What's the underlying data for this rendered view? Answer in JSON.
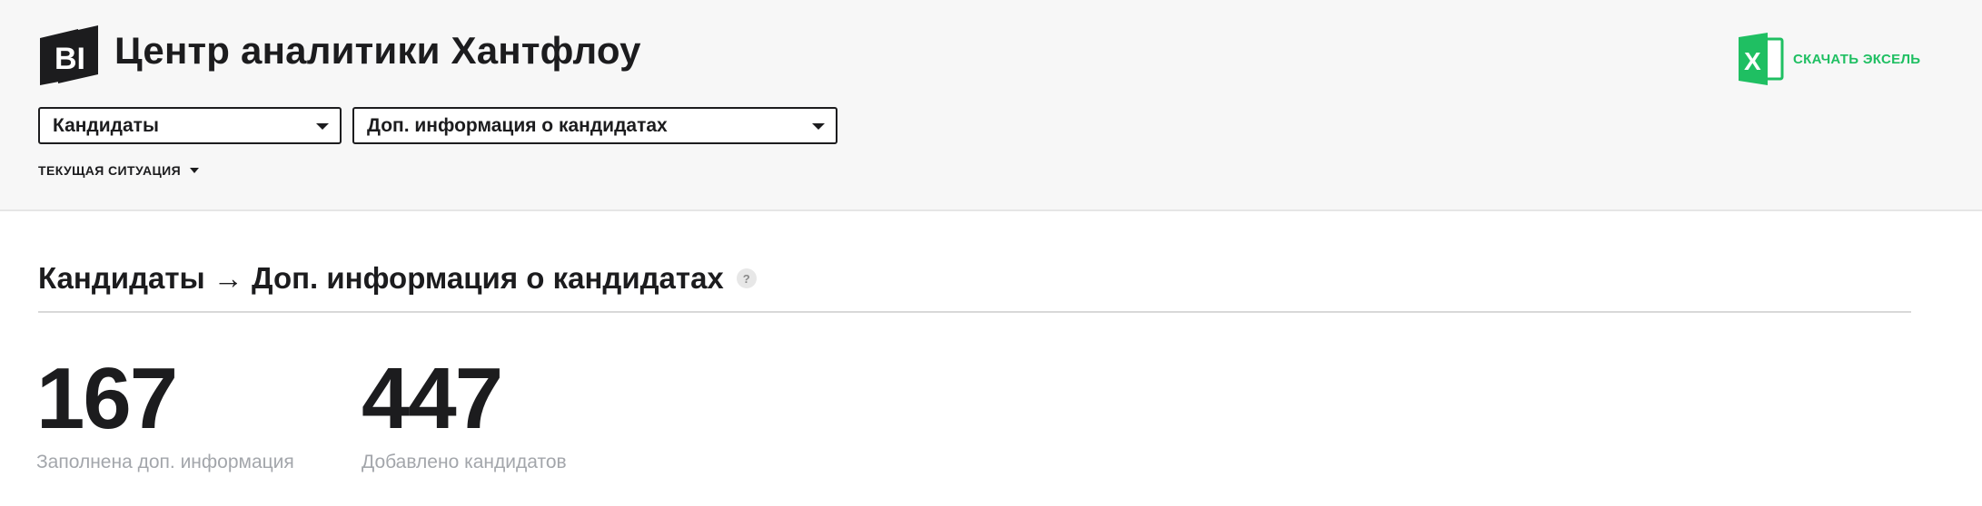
{
  "header": {
    "logo_text": "BI",
    "title": "Центр аналитики Хантфлоу",
    "excel": {
      "icon": "excel-icon",
      "icon_letter": "X",
      "label": "СКАЧАТЬ ЭКСЕЛЬ"
    },
    "selects": [
      {
        "value": "Кандидаты"
      },
      {
        "value": "Доп. информация о кандидатах"
      }
    ],
    "period": {
      "label": "ТЕКУЩАЯ СИТУАЦИЯ"
    }
  },
  "report": {
    "title": "Кандидаты → Доп. информация о кандидатах",
    "help_icon": "?",
    "metrics": [
      {
        "value": "167",
        "caption": "Заполнена доп. информация"
      },
      {
        "value": "447",
        "caption": "Добавлено кандидатов"
      }
    ]
  },
  "colors": {
    "header_bg": "#f7f7f7",
    "text": "#1c1c1e",
    "excel_green": "#1fbf62",
    "caption_gray": "#a3a6ab"
  }
}
